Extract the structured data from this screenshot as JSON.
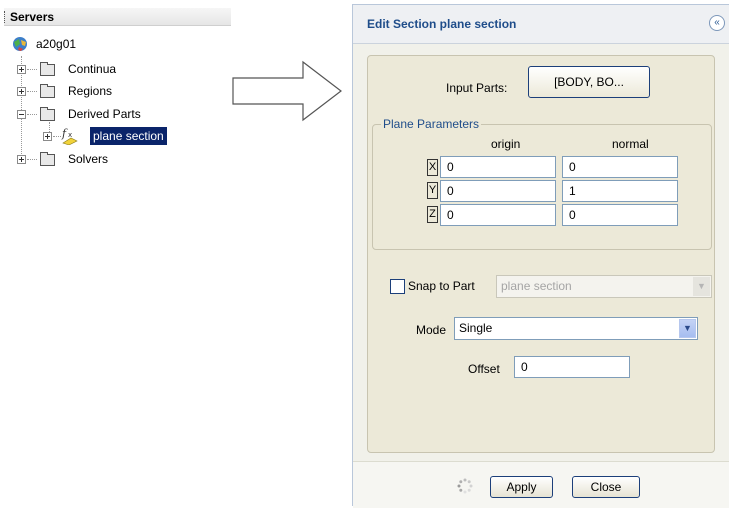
{
  "tree": {
    "header": "Servers",
    "root": "a20g01",
    "items": [
      {
        "label": "Continua"
      },
      {
        "label": "Regions"
      },
      {
        "label": "Derived Parts"
      },
      {
        "label": "plane section"
      },
      {
        "label": "Solvers"
      }
    ]
  },
  "dialog": {
    "title": "Edit Section plane section",
    "collapse_icon": "double-chevron-up-icon",
    "input_parts_label": "Input Parts:",
    "input_parts_value": "[BODY, BO...",
    "plane_params": {
      "legend": "Plane Parameters",
      "origin_header": "origin",
      "normal_header": "normal",
      "rows": [
        {
          "axis": "X",
          "origin": "0",
          "normal": "0"
        },
        {
          "axis": "Y",
          "origin": "0",
          "normal": "1"
        },
        {
          "axis": "Z",
          "origin": "0",
          "normal": "0"
        }
      ]
    },
    "snap": {
      "label": "Snap to Part",
      "checked": false,
      "value": "plane section"
    },
    "mode": {
      "label": "Mode",
      "value": "Single"
    },
    "offset": {
      "label": "Offset",
      "value": "0"
    },
    "apply_label": "Apply",
    "close_label": "Close"
  }
}
